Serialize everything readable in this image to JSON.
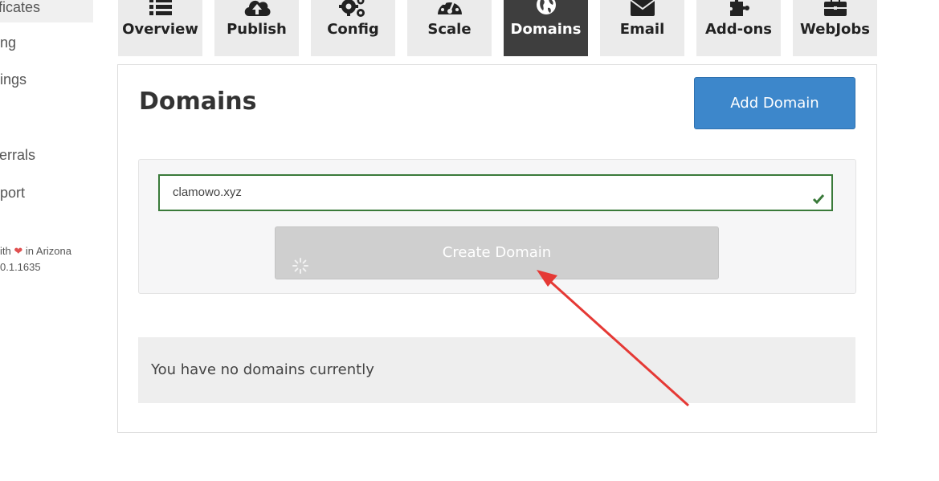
{
  "sidebar": {
    "items": [
      {
        "label": "ificates"
      },
      {
        "label": "ng"
      },
      {
        "label": "ings"
      },
      {
        "label": "errals"
      },
      {
        "label": "port"
      }
    ],
    "footer_line1_prefix": "ith",
    "footer_line1_suffix": "in Arizona",
    "footer_version": "0.1.1635"
  },
  "tabs": [
    {
      "label": "Overview",
      "icon": "list-icon"
    },
    {
      "label": "Publish",
      "icon": "cloud-upload-icon"
    },
    {
      "label": "Config",
      "icon": "gears-icon"
    },
    {
      "label": "Scale",
      "icon": "dashboard-icon"
    },
    {
      "label": "Domains",
      "icon": "globe-icon",
      "active": true
    },
    {
      "label": "Email",
      "icon": "envelope-icon"
    },
    {
      "label": "Add-ons",
      "icon": "puzzle-icon"
    },
    {
      "label": "WebJobs",
      "icon": "briefcase-icon"
    }
  ],
  "main": {
    "title": "Domains",
    "add_button": "Add Domain",
    "domain_input_value": "clamowo.xyz",
    "create_button": "Create Domain",
    "empty_message": "You have no domains currently"
  },
  "colors": {
    "accent": "#3d87cb",
    "active_tab": "#3e3e3e",
    "valid": "#3a7a3a",
    "annotation_arrow": "#e53935"
  }
}
